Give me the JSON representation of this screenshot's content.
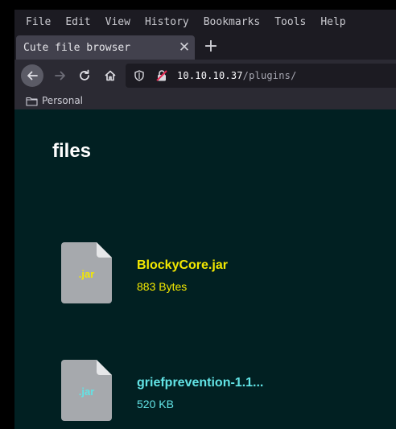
{
  "menu": [
    "File",
    "Edit",
    "View",
    "History",
    "Bookmarks",
    "Tools",
    "Help"
  ],
  "tab": {
    "title": "Cute file browser",
    "close": "✕",
    "new_tab": "+"
  },
  "url": {
    "host": "10.10.10.37",
    "path": "/plugins/"
  },
  "bookmarks": {
    "folder": "Personal"
  },
  "page": {
    "heading": "files",
    "files": [
      {
        "ext": ".jar",
        "name": "BlockyCore.jar",
        "size": "883 Bytes",
        "color": "#f3e800"
      },
      {
        "ext": ".jar",
        "name": "griefprevention-1.1...",
        "size": "520 KB",
        "color": "#62e3e5"
      }
    ]
  },
  "colors": {
    "page_bg": "#012022",
    "icon_gray": "#a6a9ad"
  }
}
